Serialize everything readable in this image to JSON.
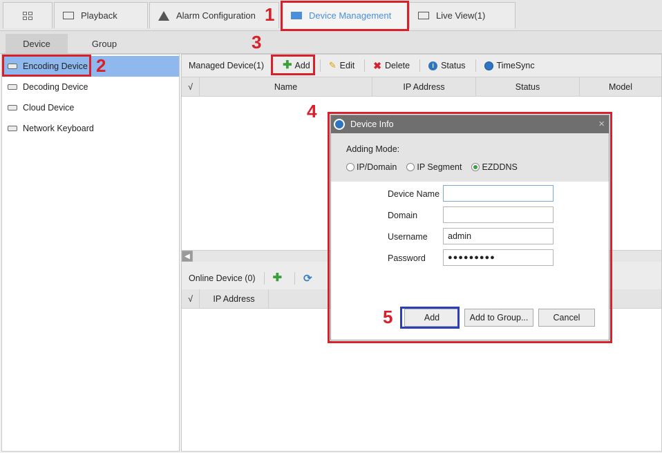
{
  "tabs": [
    {
      "label": ""
    },
    {
      "label": "Playback"
    },
    {
      "label": "Alarm Configuration"
    },
    {
      "label": "Device Management"
    },
    {
      "label": "Live View(1)"
    }
  ],
  "subtabs": [
    "Device",
    "Group"
  ],
  "sidebar": {
    "items": [
      {
        "label": "Encoding Device"
      },
      {
        "label": "Decoding Device"
      },
      {
        "label": "Cloud Device"
      },
      {
        "label": "Network Keyboard"
      }
    ]
  },
  "managed": {
    "title": "Managed Device(1)",
    "add": "Add",
    "edit": "Edit",
    "delete": "Delete",
    "status": "Status",
    "timesync": "TimeSync",
    "columns": [
      "√",
      "Name",
      "IP Address",
      "Status",
      "Model"
    ]
  },
  "online": {
    "title": "Online Device (0)",
    "columns": [
      "√",
      "IP Address"
    ]
  },
  "dialog": {
    "title": "Device Info",
    "close": "×",
    "adding_mode_label": "Adding Mode:",
    "modes": [
      "IP/Domain",
      "IP Segment",
      "EZDDNS"
    ],
    "selected_mode": "EZDDNS",
    "fields": {
      "device_name_label": "Device Name",
      "device_name_value": "",
      "domain_label": "Domain",
      "domain_value": "",
      "username_label": "Username",
      "username_value": "admin",
      "password_label": "Password",
      "password_value": "●●●●●●●●●"
    },
    "buttons": {
      "add": "Add",
      "add_to_group": "Add to Group...",
      "cancel": "Cancel"
    }
  },
  "annotations": [
    "1",
    "2",
    "3",
    "4",
    "5"
  ],
  "colors": {
    "highlight": "#d8202a",
    "selection": "#8fb9ee",
    "accent": "#4a90d9",
    "focus_box": "#2d3fb5"
  }
}
